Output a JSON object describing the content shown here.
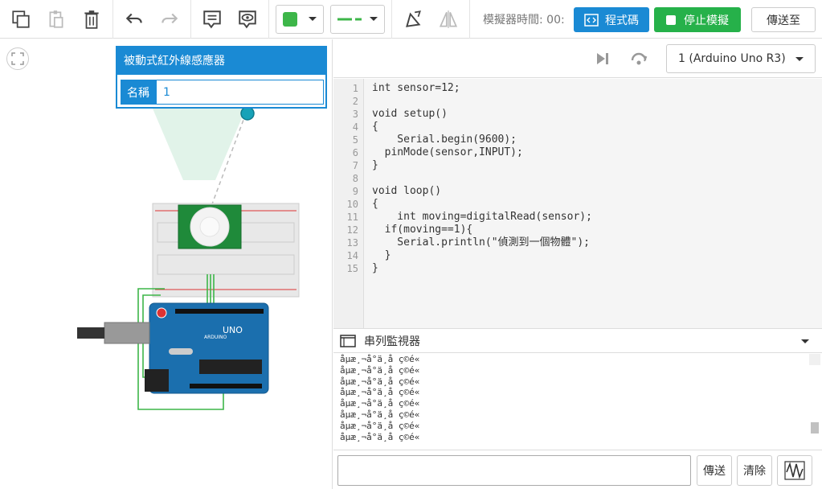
{
  "toolbar": {
    "sim_time_label": "模擬器時間: 00:",
    "code_label": "程式碼",
    "stop_label": "停止模擬",
    "send_to_label": "傳送至"
  },
  "popup": {
    "title": "被動式紅外線感應器",
    "name_label": "名稱",
    "name_value": "1"
  },
  "board": {
    "selected": "1 (Arduino Uno R3)"
  },
  "code": {
    "line_numbers": [
      "1",
      "2",
      "3",
      "4",
      "5",
      "6",
      "7",
      "8",
      "9",
      "10",
      "11",
      "12",
      "13",
      "14",
      "15"
    ],
    "lines": [
      "int sensor=12;",
      "",
      "void setup()",
      "{",
      "    Serial.begin(9600);",
      "  pinMode(sensor,INPUT);",
      "}",
      "",
      "void loop()",
      "{",
      "    int moving=digitalRead(sensor);",
      "  if(moving==1){",
      "    Serial.println(\"偵測到一個物體\");",
      "  }",
      "}"
    ]
  },
  "serial": {
    "title": "串列監視器",
    "output": [
      "åµæ¸¬å°ä¸å ç©é«",
      "åµæ¸¬å°ä¸å ç©é«",
      "åµæ¸¬å°ä¸å ç©é«",
      "åµæ¸¬å°ä¸å ç©é«",
      "åµæ¸¬å°ä¸å ç©é«",
      "åµæ¸¬å°ä¸å ç©é«",
      "åµæ¸¬å°ä¸å ç©é«",
      "åµæ¸¬å°ä¸å ç©é«"
    ],
    "send_label": "傳送",
    "clear_label": "清除"
  },
  "arduino": {
    "brand": "UNO",
    "sub": "ARDUINO"
  },
  "colors": {
    "accent": "#1a8ad4",
    "green": "#26b14a",
    "wire_color": "#3db649"
  }
}
